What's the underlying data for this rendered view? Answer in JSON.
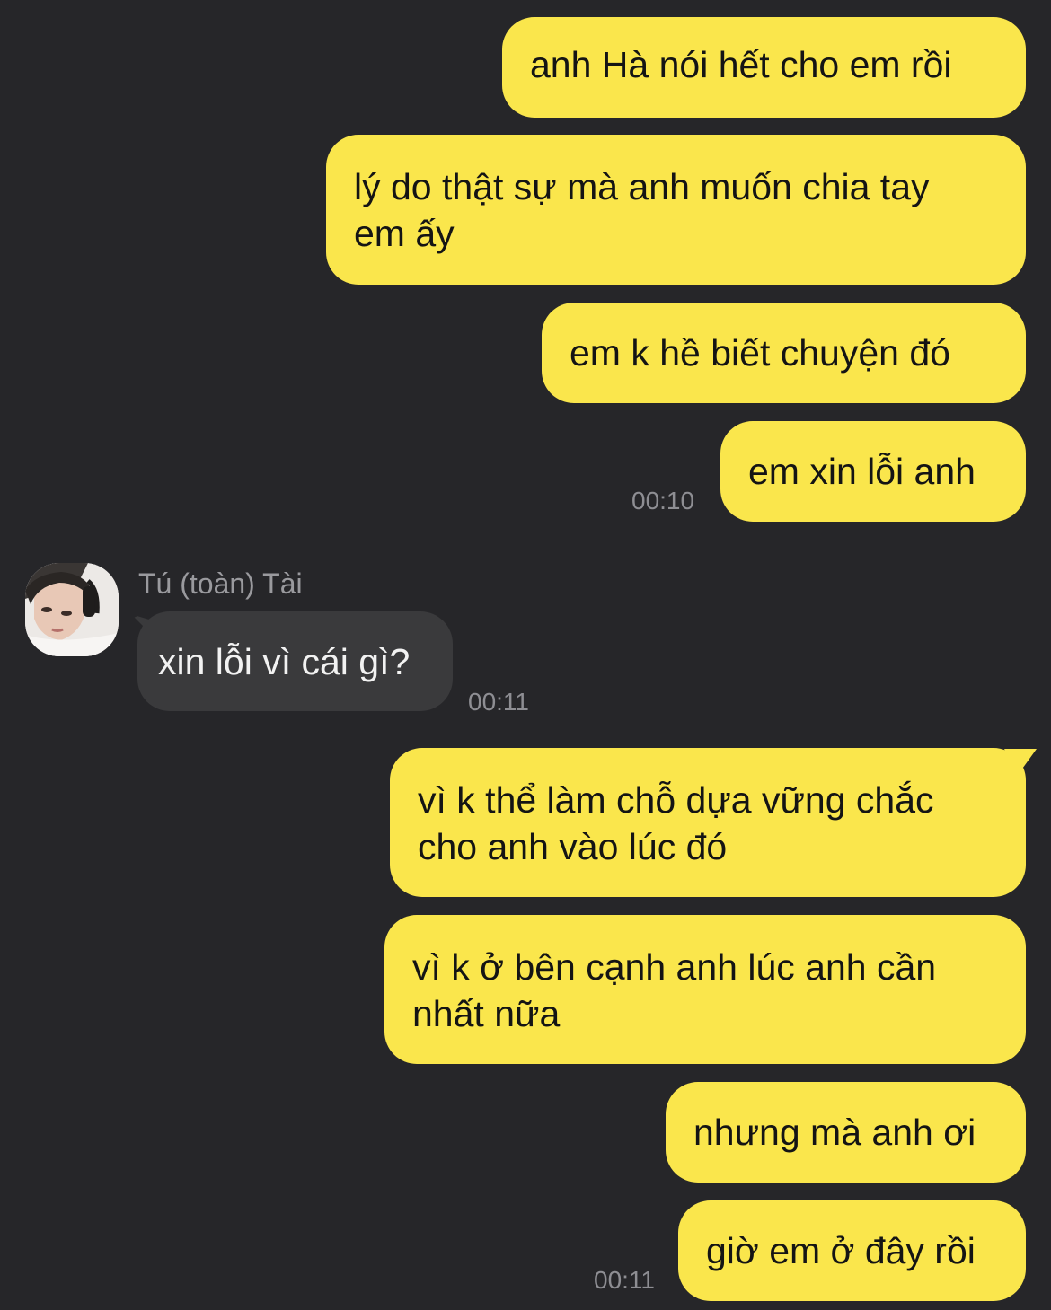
{
  "chat": {
    "outgoing_1": "anh Hà nói hết cho em rồi",
    "outgoing_2": {
      "line1": "lý do thật sự mà anh muốn chia tay",
      "line2": "em ấy"
    },
    "outgoing_3": "em k hề biết chuyện đó",
    "outgoing_4": "em xin lỗi anh",
    "time_1": "00:10",
    "sender_name": "Tú (toàn) Tài",
    "incoming_1": "xin lỗi vì cái gì?",
    "time_2": "00:11",
    "outgoing_5": {
      "line1": "vì k thể làm chỗ dựa vững chắc",
      "line2": "cho anh vào lúc đó"
    },
    "outgoing_6": {
      "line1": "vì k ở bên cạnh anh lúc anh cần",
      "line2": "nhất nữa"
    },
    "outgoing_7": "nhưng mà anh ơi",
    "outgoing_8": "giờ em ở đây rồi",
    "time_3": "00:11"
  },
  "colors": {
    "background": "#262629",
    "outgoing_bubble": "#fae64c",
    "incoming_bubble": "#3a3a3c",
    "timestamp": "#8e8e93"
  }
}
